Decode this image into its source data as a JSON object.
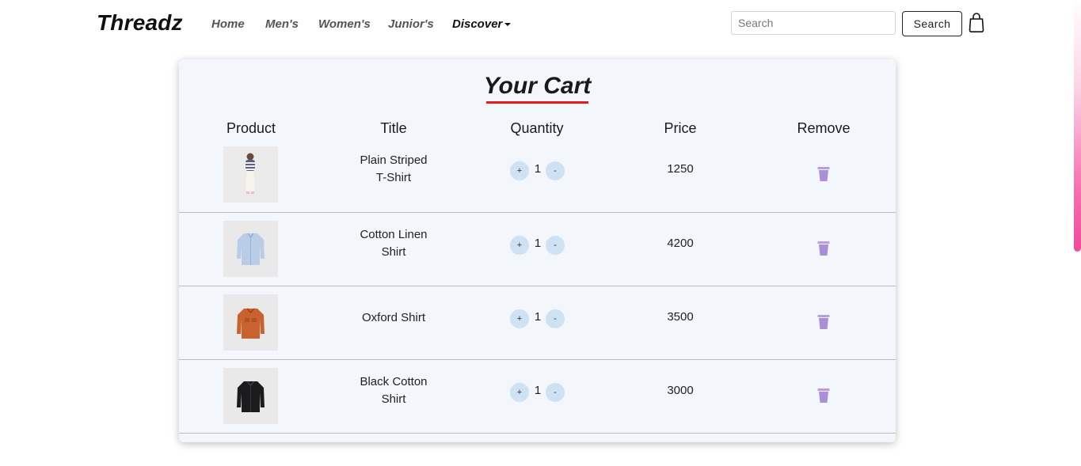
{
  "brand": "Threadz",
  "nav": {
    "home": "Home",
    "mens": "Men's",
    "womens": "Women's",
    "juniors": "Junior's",
    "discover": "Discover"
  },
  "search": {
    "placeholder": "Search",
    "button_label": "Search"
  },
  "cart": {
    "title": "Your Cart",
    "headers": {
      "product": "Product",
      "title": "Title",
      "quantity": "Quantity",
      "price": "Price",
      "remove": "Remove"
    },
    "items": [
      {
        "title_line1": "Plain Striped",
        "title_line2": "T-Shirt",
        "quantity": "1",
        "price": "1250",
        "image": "girl-striped-tshirt"
      },
      {
        "title_line1": "Cotton Linen",
        "title_line2": "Shirt",
        "quantity": "1",
        "price": "4200",
        "image": "light-blue-shirt"
      },
      {
        "title_line1": "Oxford Shirt",
        "title_line2": "",
        "quantity": "1",
        "price": "3500",
        "image": "orange-shirt"
      },
      {
        "title_line1": "Black Cotton",
        "title_line2": "Shirt",
        "quantity": "1",
        "price": "3000",
        "image": "black-shirt"
      }
    ],
    "plus_label": "+",
    "minus_label": "-"
  },
  "colors": {
    "accent_underline": "#e31b1b",
    "qty_button": "#cfe2f3",
    "trash_icon": "#a98fd6",
    "card_bg": "#f3f6fa"
  },
  "icons": [
    "shopping-bag-icon",
    "trash-icon",
    "caret-down-icon"
  ]
}
